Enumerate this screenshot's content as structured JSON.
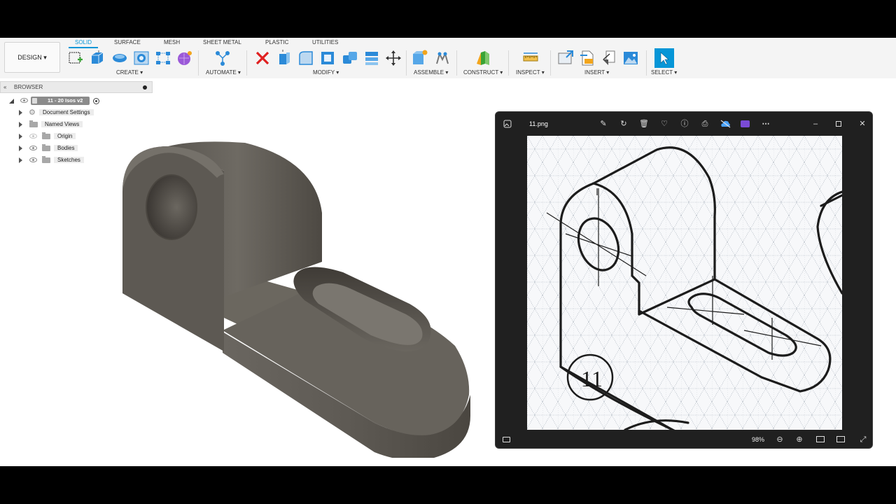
{
  "toolbar": {
    "workspace_button": "DESIGN ▾",
    "tabs": [
      "SOLID",
      "SURFACE",
      "MESH",
      "SHEET METAL",
      "PLASTIC",
      "UTILITIES"
    ],
    "groups": [
      "CREATE ▾",
      "AUTOMATE ▾",
      "MODIFY ▾",
      "ASSEMBLE ▾",
      "CONSTRUCT ▾",
      "INSPECT ▾",
      "INSERT ▾",
      "SELECT ▾"
    ]
  },
  "browser": {
    "title": "BROWSER",
    "document_name": "11 - 20 Isos v2",
    "items": [
      "Document Settings",
      "Named Views",
      "Origin",
      "Bodies",
      "Sketches"
    ]
  },
  "viewer": {
    "filename": "11.png",
    "zoom": "98%",
    "annotation": "11"
  },
  "colors": {
    "accent": "#0696d7",
    "part_face_top": "#6b6760",
    "part_face_side": "#4a4640",
    "viewer_bg": "#202020"
  }
}
